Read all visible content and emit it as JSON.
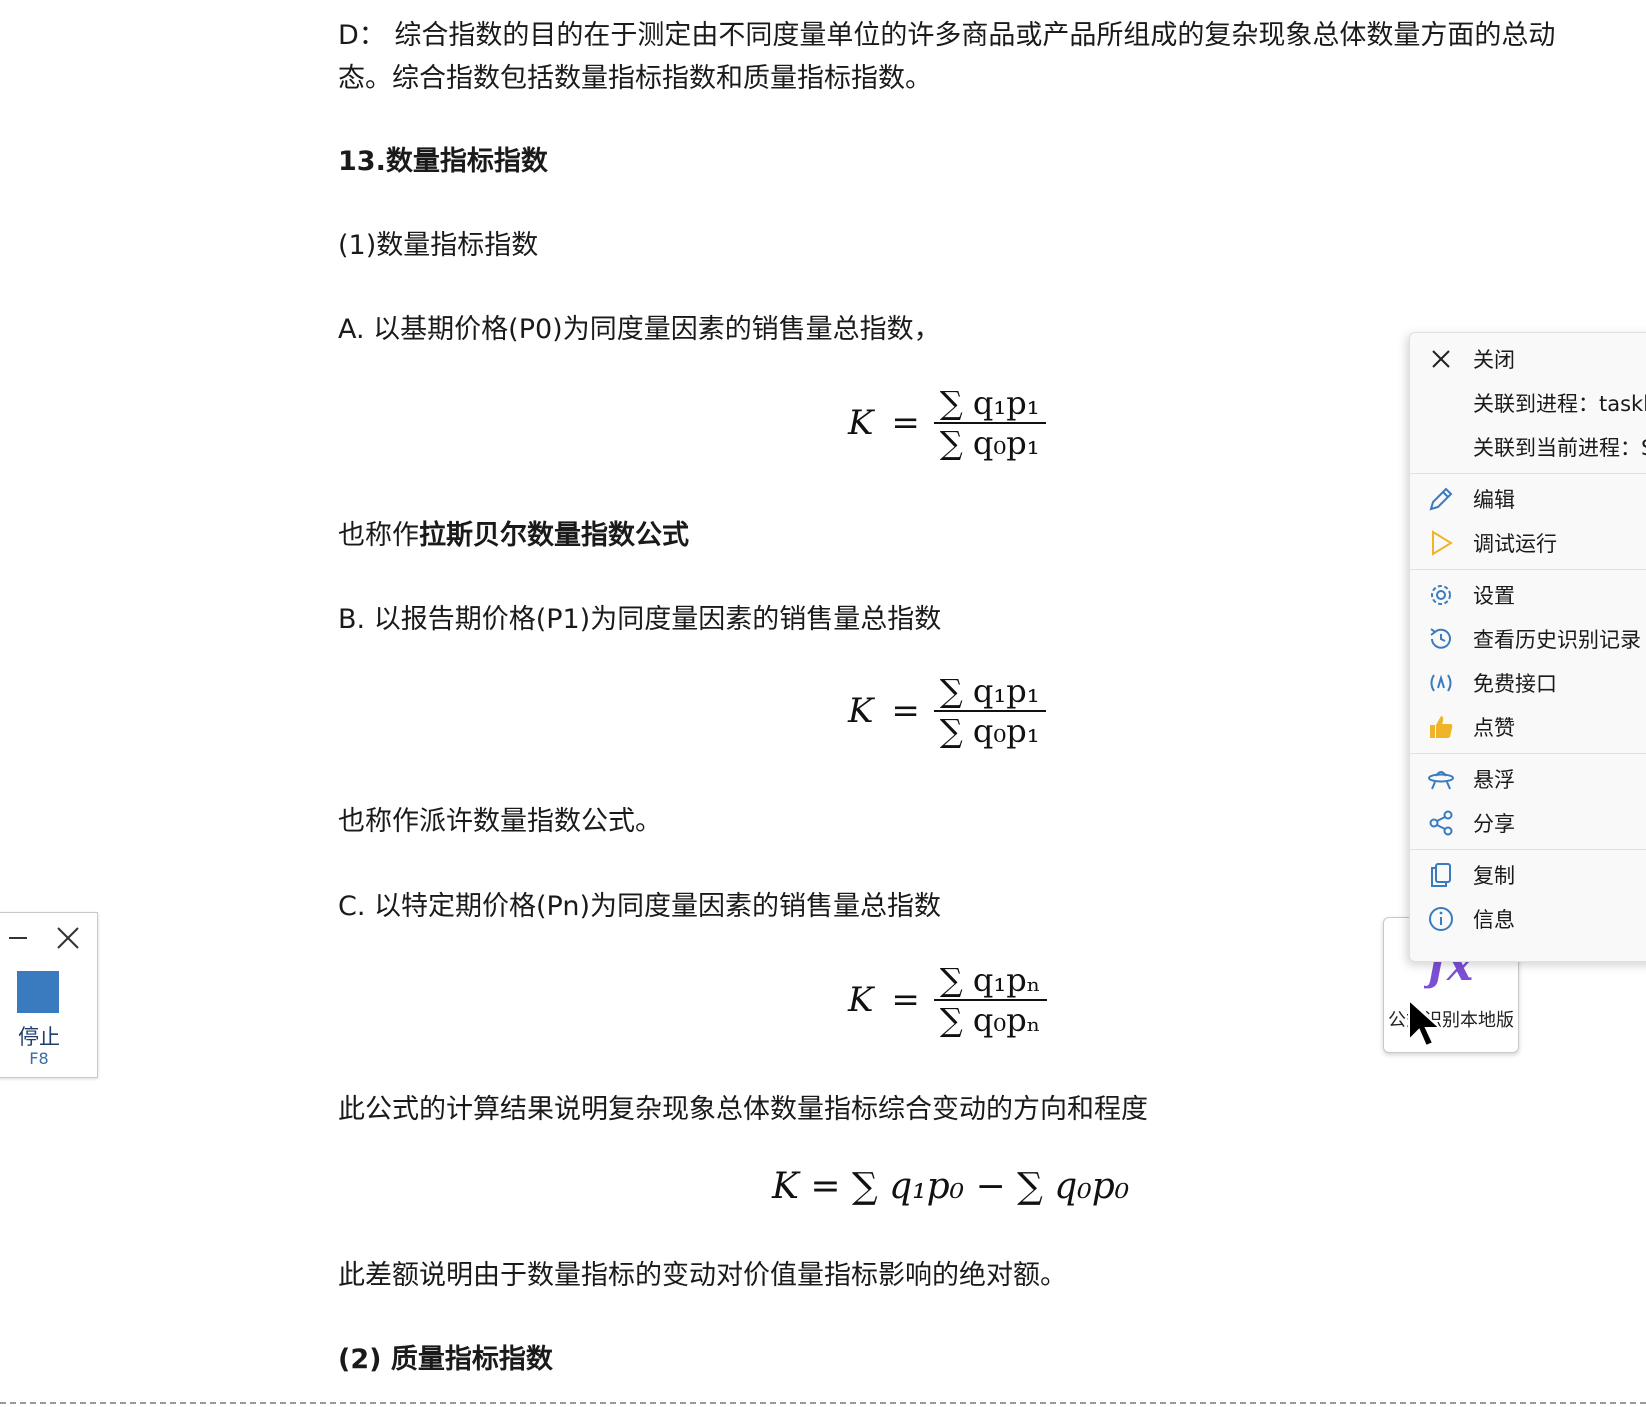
{
  "doc": {
    "para_d": "D：  综合指数的目的在于测定由不同度量单位的许多商品或产品所组成的复杂现象总体数量方面的总动态。综合指数包括数量指标指数和质量指标指数。",
    "heading_13": "13.数量指标指数",
    "sub_1": "(1)数量指标指数",
    "item_a": "A. 以基期价格(P0)为同度量因素的销售量总指数，",
    "laspeyres_prefix": "也称作",
    "laspeyres_bold": "拉斯贝尔数量指数公式",
    "item_b": "B. 以报告期价格(P1)为同度量因素的销售量总指数",
    "paasche": "也称作派许数量指数公式。",
    "item_c": "C. 以特定期价格(Pn)为同度量因素的销售量总指数",
    "result_note": "此公式的计算结果说明复杂现象总体数量指标综合变动的方向和程度",
    "diff_note": "此差额说明由于数量指标的变动对价值量指标影响的绝对额。",
    "heading_2": "(2) 质量指标指数"
  },
  "formulas": {
    "a": {
      "lhs": "K",
      "eq": "=",
      "num": "∑ q₁p₁",
      "den": "∑ q₀p₁"
    },
    "b": {
      "lhs": "K",
      "eq": "=",
      "num": "∑ q₁p₁",
      "den": "∑ q₀p₁"
    },
    "c": {
      "lhs": "K",
      "eq": "=",
      "num": "∑ q₁pₙ",
      "den": "∑ q₀pₙ"
    },
    "diff": {
      "text": "K = ∑ q₁p₀ − ∑ q₀p₀"
    }
  },
  "stop_widget": {
    "label": "停止",
    "hotkey": "F8",
    "icons": [
      "minimize-icon",
      "close-icon",
      "stop-square-icon"
    ],
    "accent": "#3a7bbf"
  },
  "formula_button": {
    "label": "公式识别本地版",
    "icon": "fx-icon",
    "icon_color": "#7b4fd6"
  },
  "context_menu": {
    "items": [
      {
        "label": "关闭",
        "icon": "close-icon"
      },
      {
        "label": "关联到进程：taskb",
        "icon": ""
      },
      {
        "label": "关联到当前进程：S",
        "icon": ""
      },
      {
        "label": "编辑",
        "icon": "pencil-icon"
      },
      {
        "label": "调试运行",
        "icon": "play-icon"
      },
      {
        "label": "设置",
        "icon": "gear-icon"
      },
      {
        "label": "查看历史识别记录",
        "icon": "history-icon"
      },
      {
        "label": "免费接口",
        "icon": "api-icon"
      },
      {
        "label": "点赞",
        "icon": "thumbs-up-icon"
      },
      {
        "label": "悬浮",
        "icon": "ufo-icon"
      },
      {
        "label": "分享",
        "icon": "share-icon"
      },
      {
        "label": "复制",
        "icon": "copy-icon"
      },
      {
        "label": "信息",
        "icon": "info-icon"
      }
    ]
  }
}
